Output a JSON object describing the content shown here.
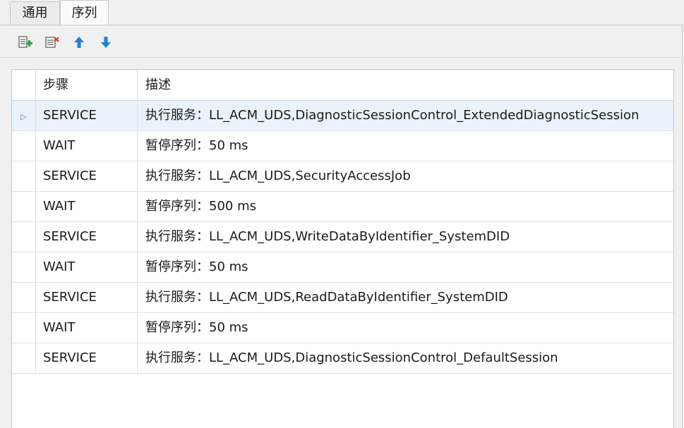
{
  "tabs": [
    {
      "label": "通用",
      "active": false
    },
    {
      "label": "序列",
      "active": true
    }
  ],
  "toolbar": {
    "buttons": [
      {
        "name": "add-step-button",
        "icon": "add-row-icon"
      },
      {
        "name": "delete-step-button",
        "icon": "delete-row-icon"
      },
      {
        "name": "move-up-button",
        "icon": "arrow-up-icon"
      },
      {
        "name": "move-down-button",
        "icon": "arrow-down-icon"
      }
    ]
  },
  "grid": {
    "columns": [
      "步骤",
      "描述"
    ],
    "rows": [
      {
        "step": "SERVICE",
        "desc": "执行服务：LL_ACM_UDS,DiagnosticSessionControl_ExtendedDiagnosticSession",
        "selected": true
      },
      {
        "step": "WAIT",
        "desc": "暂停序列：50 ms",
        "selected": false
      },
      {
        "step": "SERVICE",
        "desc": "执行服务：LL_ACM_UDS,SecurityAccessJob",
        "selected": false
      },
      {
        "step": "WAIT",
        "desc": "暂停序列：500 ms",
        "selected": false
      },
      {
        "step": "SERVICE",
        "desc": "执行服务：LL_ACM_UDS,WriteDataByIdentifier_SystemDID",
        "selected": false
      },
      {
        "step": "WAIT",
        "desc": "暂停序列：50 ms",
        "selected": false
      },
      {
        "step": "SERVICE",
        "desc": "执行服务：LL_ACM_UDS,ReadDataByIdentifier_SystemDID",
        "selected": false
      },
      {
        "step": "WAIT",
        "desc": "暂停序列：50 ms",
        "selected": false
      },
      {
        "step": "SERVICE",
        "desc": "执行服务：LL_ACM_UDS,DiagnosticSessionControl_DefaultSession",
        "selected": false
      }
    ]
  },
  "colors": {
    "accent": "#1e7fd6",
    "selection": "#eaf3fc"
  }
}
